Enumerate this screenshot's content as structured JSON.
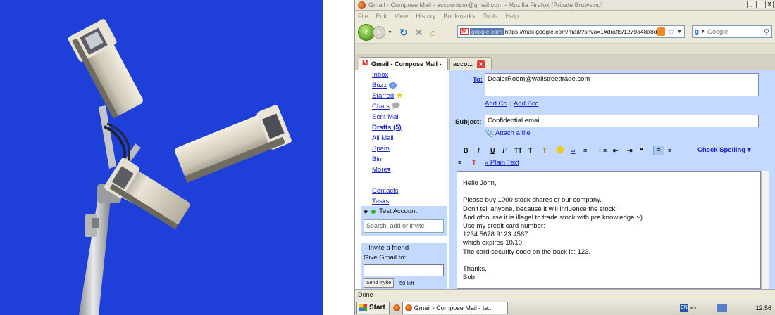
{
  "browser": {
    "title": "Gmail - Compose Mail - accountsm@gmail.com - Mozilla Firefox (Private Browsing)",
    "window_buttons": [
      "_",
      " ",
      "X"
    ],
    "menu": [
      "File",
      "Edit",
      "View",
      "History",
      "Bookmarks",
      "Tools",
      "Help"
    ],
    "url_site": "google.com",
    "url": "https://mail.google.com/mail/?shva=1#drafts/1279a48a8d",
    "search_placeholder": "Google",
    "tab_active": "Gmail - Compose Mail -",
    "tab_other": "acco...",
    "status": "Done"
  },
  "gmail": {
    "nav": [
      "Inbox",
      "Buzz",
      "Starred",
      "Chats",
      "Sent Mail",
      "Drafts (5)",
      "All Mail",
      "Spam",
      "Bin",
      "More▾",
      "Contacts",
      "Tasks"
    ],
    "chat_title": "Test Account",
    "chat_search_placeholder": "Search, add or invite",
    "invite_title": "Invite a friend",
    "invite_label": "Give Gmail to:",
    "invite_button": "Send Invite",
    "invites_left": "50 left"
  },
  "compose": {
    "to_label": "To:",
    "to_value": "DealerRoom@wallstreettrade.com",
    "add_cc": "Add Cc",
    "sep": "|",
    "add_bcc": "Add Bcc",
    "subject_label": "Subject:",
    "subject_value": "Confidential email.",
    "attach": "Attach a file",
    "check_spelling": "Check Spelling ▾",
    "plain_text": "« Plain Text",
    "body_lines": [
      "Hello John,",
      "",
      "Please buy 1000 stock shares of our company.",
      "Don't tell anyone, because it will influence the stock.",
      "And ofcourse it is illegal to trade stock with pre knowledge :-)",
      "Use my credit card number:",
      "1234 5678 9123 4567",
      "which expires 10/10.",
      "The card security code on the back is: 123.",
      "",
      "Thanks,",
      "Bob"
    ]
  },
  "taskbar": {
    "start": "Start",
    "task": "Gmail - Compose Mail - te...",
    "lang": "<<",
    "clock": "12:56"
  },
  "colors": {
    "sky": "#1f3fd9",
    "gmail_blue": "#c3d9ff",
    "link": "#1a24c5"
  }
}
